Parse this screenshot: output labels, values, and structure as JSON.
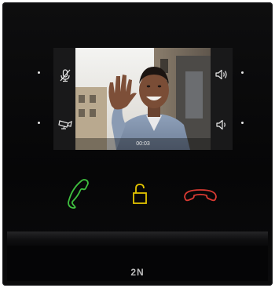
{
  "call": {
    "timer": "00:03",
    "call_state": "connected"
  },
  "left_controls": [
    {
      "icon": "microphone-muted-icon"
    },
    {
      "icon": "camera-icon"
    }
  ],
  "right_controls": [
    {
      "icon": "speaker-volume-up-icon"
    },
    {
      "icon": "speaker-volume-down-icon"
    }
  ],
  "buttons": [
    {
      "icon": "answer-call-icon",
      "color": "#3fbf3f"
    },
    {
      "icon": "unlock-door-icon",
      "color": "#e3c400"
    },
    {
      "icon": "end-call-icon",
      "color": "#d93a32"
    }
  ],
  "brand": {
    "logo_text": "2N"
  },
  "colors": {
    "device_body": "#0b0b0c",
    "indicator_dot": "#e6e6e6",
    "accept": "#3fbf3f",
    "unlock": "#e3c400",
    "decline": "#d93a32"
  }
}
